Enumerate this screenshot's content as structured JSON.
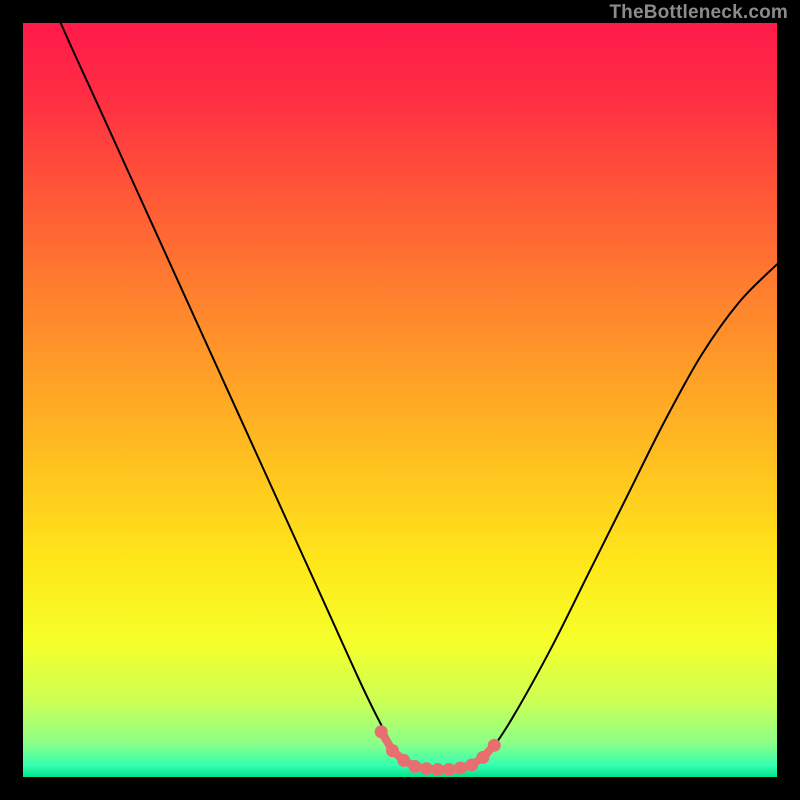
{
  "watermark": "TheBottleneck.com",
  "colors": {
    "bg": "#000000",
    "gradient_stops": [
      {
        "offset": 0.0,
        "color": "#ff1a4a"
      },
      {
        "offset": 0.1,
        "color": "#ff2e43"
      },
      {
        "offset": 0.22,
        "color": "#ff5538"
      },
      {
        "offset": 0.35,
        "color": "#ff7d2f"
      },
      {
        "offset": 0.48,
        "color": "#ffa326"
      },
      {
        "offset": 0.6,
        "color": "#ffc61f"
      },
      {
        "offset": 0.72,
        "color": "#ffe81a"
      },
      {
        "offset": 0.82,
        "color": "#f6ff2a"
      },
      {
        "offset": 0.9,
        "color": "#ccff55"
      },
      {
        "offset": 0.955,
        "color": "#8cff88"
      },
      {
        "offset": 0.985,
        "color": "#33ffb0"
      },
      {
        "offset": 1.0,
        "color": "#00e28c"
      }
    ],
    "curve": "#000000",
    "marker_fill": "#e86f6f",
    "marker_stroke": "#e86f6f"
  },
  "chart_data": {
    "type": "line",
    "title": "",
    "xlabel": "",
    "ylabel": "",
    "xlim": [
      0,
      100
    ],
    "ylim": [
      0,
      100
    ],
    "series": [
      {
        "name": "bottleneck-curve",
        "x": [
          0,
          5,
          10,
          15,
          20,
          25,
          30,
          35,
          40,
          45,
          48,
          50,
          52,
          54,
          56,
          58,
          60,
          62,
          65,
          70,
          75,
          80,
          85,
          90,
          95,
          100
        ],
        "values": [
          112,
          100,
          89,
          78,
          67,
          56,
          45,
          34,
          23,
          12,
          6.0,
          2.8,
          1.4,
          1.0,
          1.0,
          1.2,
          1.8,
          3.5,
          8,
          17,
          27,
          37,
          47,
          56,
          63,
          68
        ]
      }
    ],
    "markers": {
      "name": "sweet-spot",
      "x": [
        47.5,
        49.0,
        50.5,
        52.0,
        53.5,
        55.0,
        56.5,
        58.0,
        59.5,
        61.0,
        62.5
      ],
      "values": [
        6.0,
        3.5,
        2.2,
        1.4,
        1.1,
        1.0,
        1.0,
        1.2,
        1.6,
        2.6,
        4.2
      ]
    }
  }
}
